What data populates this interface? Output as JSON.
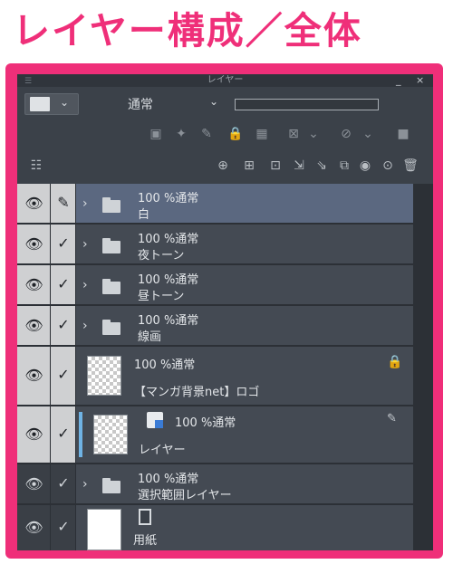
{
  "heading": "レイヤー構成／全体",
  "panel": {
    "title": "レイヤー",
    "controls": {
      "minimize": "_",
      "close": "×"
    },
    "blend_mode": "通常",
    "colors": {
      "accent": "#ef2f79",
      "selected_row": "#5b6880",
      "panel_bg": "#3b4149"
    }
  },
  "layers": [
    {
      "opacity_mode": "100 %通常",
      "name": "白",
      "type": "folder",
      "selected": true
    },
    {
      "opacity_mode": "100 %通常",
      "name": "夜トーン",
      "type": "folder"
    },
    {
      "opacity_mode": "100 %通常",
      "name": "昼トーン",
      "type": "folder"
    },
    {
      "opacity_mode": "100 %通常",
      "name": "線画",
      "type": "folder"
    },
    {
      "opacity_mode": "100 %通常",
      "name": "【マンガ背景net】ロゴ",
      "type": "raster",
      "locked": true
    },
    {
      "opacity_mode": "100 %通常",
      "name": "レイヤー",
      "type": "raster"
    },
    {
      "opacity_mode": "100 %通常",
      "name": "選択範囲レイヤー",
      "type": "folder"
    },
    {
      "opacity_mode": "",
      "name": "用紙",
      "type": "paper"
    }
  ]
}
